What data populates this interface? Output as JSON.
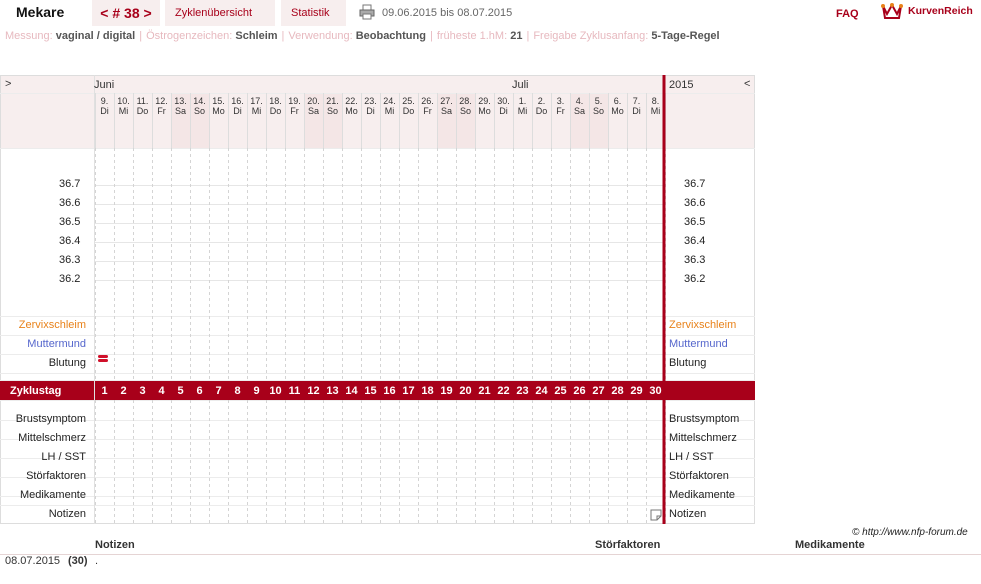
{
  "header": {
    "user_name": "Mekare",
    "cycle_nav": "< # 38 >",
    "tab_overview": "Zyklenübersicht",
    "tab_stats": "Statistik",
    "date_range": "09.06.2015 bis 08.07.2015",
    "faq": "FAQ",
    "logo_text": "KurvenReich"
  },
  "settings": [
    {
      "label": "Messung:",
      "value": "vaginal / digital"
    },
    {
      "label": "Östrogenzeichen:",
      "value": "Schleim"
    },
    {
      "label": "Verwendung:",
      "value": "Beobachtung"
    },
    {
      "label": "früheste 1.hM:",
      "value": "21"
    },
    {
      "label": "Freigabe Zyklusanfang:",
      "value": "5-Tage-Regel"
    }
  ],
  "chart": {
    "nav_left": ">",
    "nav_right": "<",
    "year": "2015",
    "months": [
      {
        "name": "Juni",
        "start_index": 0
      },
      {
        "name": "Juli",
        "start_index": 22
      }
    ],
    "days": [
      {
        "d": "9.",
        "w": "Di",
        "we": false
      },
      {
        "d": "10.",
        "w": "Mi",
        "we": false
      },
      {
        "d": "11.",
        "w": "Do",
        "we": false
      },
      {
        "d": "12.",
        "w": "Fr",
        "we": false
      },
      {
        "d": "13.",
        "w": "Sa",
        "we": true
      },
      {
        "d": "14.",
        "w": "So",
        "we": true
      },
      {
        "d": "15.",
        "w": "Mo",
        "we": false
      },
      {
        "d": "16.",
        "w": "Di",
        "we": false
      },
      {
        "d": "17.",
        "w": "Mi",
        "we": false
      },
      {
        "d": "18.",
        "w": "Do",
        "we": false
      },
      {
        "d": "19.",
        "w": "Fr",
        "we": false
      },
      {
        "d": "20.",
        "w": "Sa",
        "we": true
      },
      {
        "d": "21.",
        "w": "So",
        "we": true
      },
      {
        "d": "22.",
        "w": "Mo",
        "we": false
      },
      {
        "d": "23.",
        "w": "Di",
        "we": false
      },
      {
        "d": "24.",
        "w": "Mi",
        "we": false
      },
      {
        "d": "25.",
        "w": "Do",
        "we": false
      },
      {
        "d": "26.",
        "w": "Fr",
        "we": false
      },
      {
        "d": "27.",
        "w": "Sa",
        "we": true
      },
      {
        "d": "28.",
        "w": "So",
        "we": true
      },
      {
        "d": "29.",
        "w": "Mo",
        "we": false
      },
      {
        "d": "30.",
        "w": "Di",
        "we": false
      },
      {
        "d": "1.",
        "w": "Mi",
        "we": false
      },
      {
        "d": "2.",
        "w": "Do",
        "we": false
      },
      {
        "d": "3.",
        "w": "Fr",
        "we": false
      },
      {
        "d": "4.",
        "w": "Sa",
        "we": true
      },
      {
        "d": "5.",
        "w": "So",
        "we": true
      },
      {
        "d": "6.",
        "w": "Mo",
        "we": false
      },
      {
        "d": "7.",
        "w": "Di",
        "we": false
      },
      {
        "d": "8.",
        "w": "Mi",
        "we": false
      }
    ],
    "temperatures": [
      "36.7",
      "36.6",
      "36.5",
      "36.4",
      "36.3",
      "36.2"
    ],
    "rows_top": [
      {
        "label": "Zervixschleim",
        "color": "#e8821a"
      },
      {
        "label": "Muttermund",
        "color": "#5566cc"
      },
      {
        "label": "Blutung",
        "color": "#222222"
      }
    ],
    "cycle_label": "Zyklustag",
    "cycle_days": [
      "1",
      "2",
      "3",
      "4",
      "5",
      "6",
      "7",
      "8",
      "9",
      "10",
      "11",
      "12",
      "13",
      "14",
      "15",
      "16",
      "17",
      "18",
      "19",
      "20",
      "21",
      "22",
      "23",
      "24",
      "25",
      "26",
      "27",
      "28",
      "29",
      "30"
    ],
    "rows_bottom": [
      "Brustsymptom",
      "Mittelschmerz",
      "LH / SST",
      "Störfaktoren",
      "Medikamente",
      "Notizen"
    ],
    "bleeding_day_index": 0,
    "note_day_index": 29
  },
  "footer": {
    "copyright": "© http://www.nfp-forum.de",
    "col_notes": "Notizen",
    "col_stoer": "Störfaktoren",
    "col_med": "Medikamente",
    "entry_date": "08.07.2015",
    "entry_cycle": "(30)",
    "entry_text": "."
  },
  "colors": {
    "accent": "#a8001a",
    "weekend": "#f4e6e6",
    "grid": "#d7d7d7"
  }
}
